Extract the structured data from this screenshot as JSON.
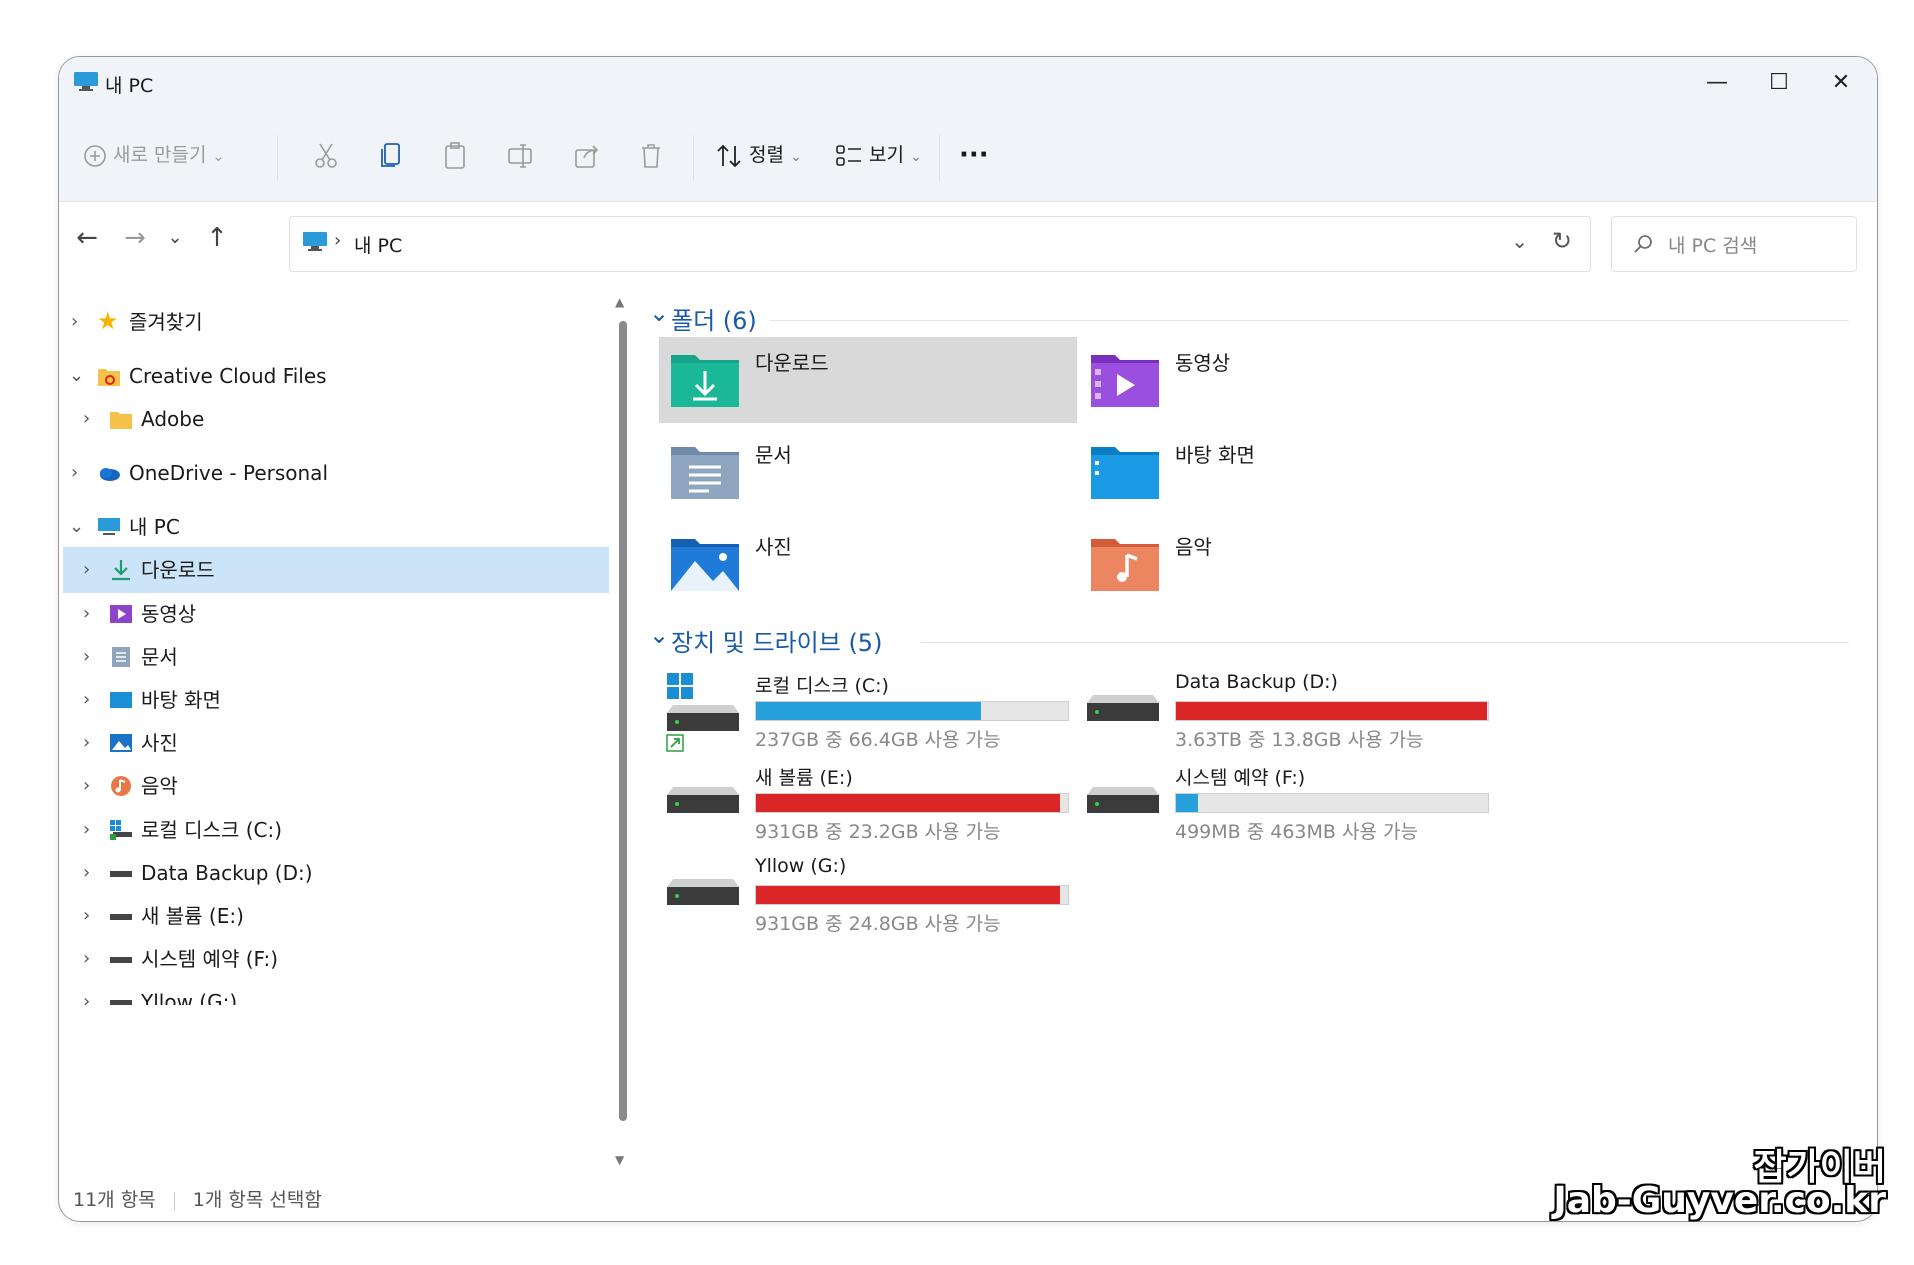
{
  "window": {
    "title": "내 PC"
  },
  "toolbar": {
    "new_label": "새로 만들기",
    "sort_label": "정렬",
    "view_label": "보기",
    "more_label": "···"
  },
  "nav": {
    "address_path": "내 PC",
    "search_placeholder": "내 PC 검색"
  },
  "sidebar": {
    "items": [
      {
        "label": "즐겨찾기"
      },
      {
        "label": "Creative Cloud Files"
      },
      {
        "label": "Adobe"
      },
      {
        "label": "OneDrive - Personal"
      },
      {
        "label": "내 PC"
      },
      {
        "label": "다운로드"
      },
      {
        "label": "동영상"
      },
      {
        "label": "문서"
      },
      {
        "label": "바탕 화면"
      },
      {
        "label": "사진"
      },
      {
        "label": "음악"
      },
      {
        "label": "로컬 디스크 (C:)"
      },
      {
        "label": "Data Backup (D:)"
      },
      {
        "label": "새 볼륨 (E:)"
      },
      {
        "label": "시스템 예약 (F:)"
      },
      {
        "label": "Yllow (G:)"
      }
    ]
  },
  "folders": {
    "header": "폴더 (6)",
    "items": [
      {
        "label": "다운로드",
        "icon": "download-folder-icon"
      },
      {
        "label": "동영상",
        "icon": "videos-folder-icon"
      },
      {
        "label": "문서",
        "icon": "documents-folder-icon"
      },
      {
        "label": "바탕 화면",
        "icon": "desktop-folder-icon"
      },
      {
        "label": "사진",
        "icon": "pictures-folder-icon"
      },
      {
        "label": "음악",
        "icon": "music-folder-icon"
      }
    ]
  },
  "drives": {
    "header": "장치 및 드라이브 (5)",
    "items": [
      {
        "name": "로컬 디스크 (C:)",
        "usage": "237GB 중 66.4GB 사용 가능",
        "used_fraction": 0.72,
        "color": "#26a0da"
      },
      {
        "name": "Data Backup (D:)",
        "usage": "3.63TB 중 13.8GB 사용 가능",
        "used_fraction": 0.996,
        "color": "#da2626"
      },
      {
        "name": "새 볼륨 (E:)",
        "usage": "931GB 중 23.2GB 사용 가능",
        "used_fraction": 0.975,
        "color": "#da2626"
      },
      {
        "name": "시스템 예약 (F:)",
        "usage": "499MB 중 463MB 사용 가능",
        "used_fraction": 0.072,
        "color": "#26a0da"
      },
      {
        "name": "Yllow (G:)",
        "usage": "931GB 중 24.8GB 사용 가능",
        "used_fraction": 0.973,
        "color": "#da2626"
      }
    ]
  },
  "status": {
    "count": "11개 항목",
    "selected": "1개 항목 선택함"
  },
  "watermark": {
    "line1": "잡가이버",
    "line2": "Jab-Guyver.co.kr"
  }
}
